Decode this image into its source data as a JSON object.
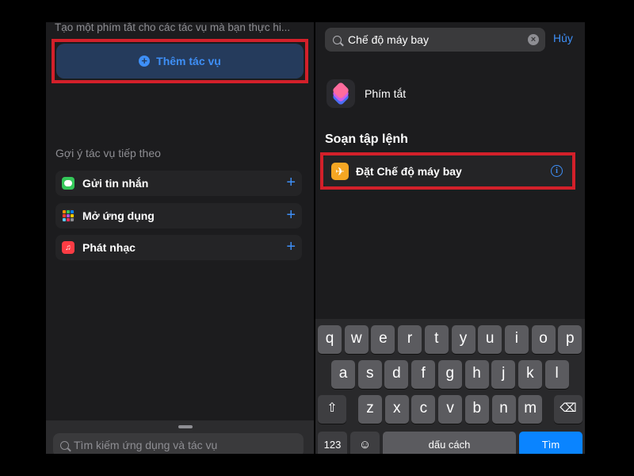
{
  "left_panel": {
    "hint_text": "Tạo một phím tắt cho các tác vụ mà bạn thực hi...",
    "add_action_label": "Thêm tác vụ",
    "suggestions_title": "Gợi ý tác vụ tiếp theo",
    "suggestions": [
      {
        "label": "Gửi tin nhắn",
        "icon": "messages-icon"
      },
      {
        "label": "Mở ứng dụng",
        "icon": "app-grid-icon"
      },
      {
        "label": "Phát nhạc",
        "icon": "music-icon"
      }
    ],
    "search_placeholder": "Tìm kiếm ứng dụng và tác vụ"
  },
  "right_panel": {
    "search_value": "Chế độ máy bay",
    "cancel_label": "Hủy",
    "app_result_label": "Phím tắt",
    "section_title": "Soạn tập lệnh",
    "action_label": "Đặt Chế độ máy bay"
  },
  "keyboard": {
    "row1": [
      "q",
      "w",
      "e",
      "r",
      "t",
      "y",
      "u",
      "i",
      "o",
      "p"
    ],
    "row2": [
      "a",
      "s",
      "d",
      "f",
      "g",
      "h",
      "j",
      "k",
      "l"
    ],
    "row3": [
      "z",
      "x",
      "c",
      "v",
      "b",
      "n",
      "m"
    ],
    "numbers_label": "123",
    "space_label": "dấu cách",
    "search_label": "Tìm"
  },
  "colors": {
    "accent": "#3e8ff7",
    "highlight_border": "#d3202a",
    "panel_bg": "#1c1c1e",
    "airplane_orange": "#f5a623"
  }
}
